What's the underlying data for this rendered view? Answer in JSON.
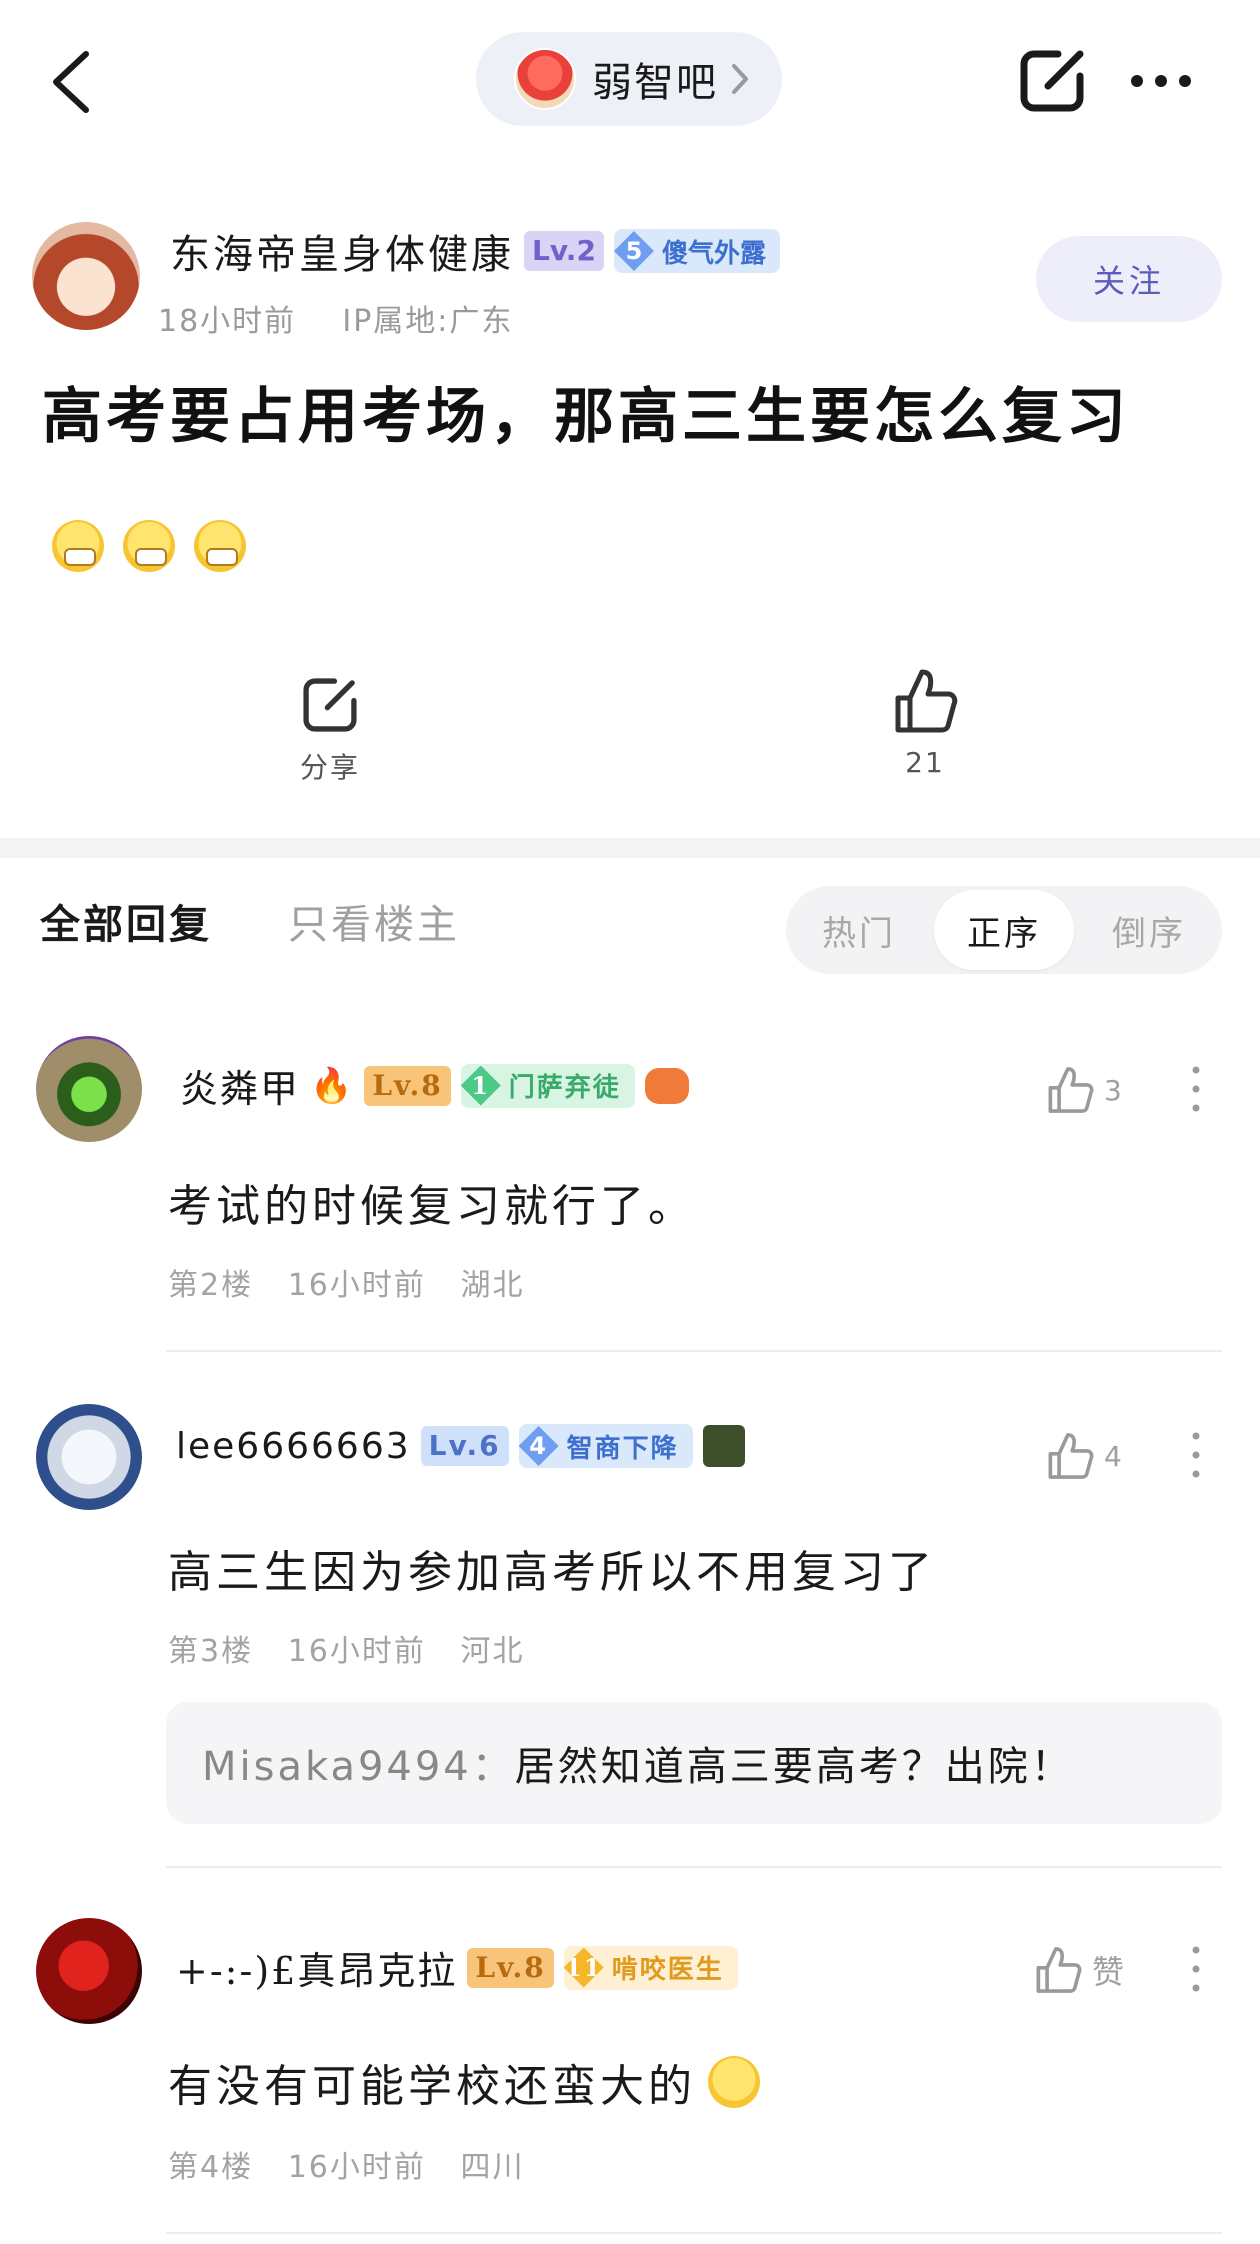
{
  "topbar": {
    "forum_name": "弱智吧"
  },
  "post": {
    "author": {
      "name": "东海帝皇身体健康",
      "level": "Lv.2",
      "badge_num": "5",
      "badge_text": "傻气外露",
      "time": "18小时前",
      "ip": "IP属地:广东"
    },
    "follow_label": "关注",
    "title": "高考要占用考场，那高三生要怎么复习",
    "emojis": [
      "grimace-emoji",
      "grimace-emoji",
      "grimace-emoji"
    ],
    "share_label": "分享",
    "like_count": "21"
  },
  "tabs": {
    "all": "全部回复",
    "owner_only": "只看楼主"
  },
  "sort": {
    "hot": "热门",
    "asc": "正序",
    "desc": "倒序"
  },
  "comments": [
    {
      "name": "炎粦甲",
      "level": "Lv.8",
      "badge_num": "1",
      "badge_text": "门萨弃徒",
      "text": "考试的时候复习就行了。",
      "floor": "第2楼",
      "time": "16小时前",
      "location": "湖北",
      "likes": "3"
    },
    {
      "name": "lee6666663",
      "level": "Lv.6",
      "badge_num": "4",
      "badge_text": "智商下降",
      "text": "高三生因为参加高考所以不用复习了",
      "floor": "第3楼",
      "time": "16小时前",
      "location": "河北",
      "likes": "4",
      "reply": {
        "user": "Misaka9494：",
        "text": "居然知道高三要高考？出院！"
      }
    },
    {
      "name": "+-:-)£真昂克拉",
      "level": "Lv.8",
      "badge_num": "11",
      "badge_text": "啃咬医生",
      "text": "有没有可能学校还蛮大的",
      "floor": "第4楼",
      "time": "16小时前",
      "location": "四川",
      "likes": "赞"
    }
  ],
  "colors": {
    "accent": "#5b5bbd",
    "gray_text": "#a3a3a3",
    "pill_bg": "#eef0f8"
  }
}
